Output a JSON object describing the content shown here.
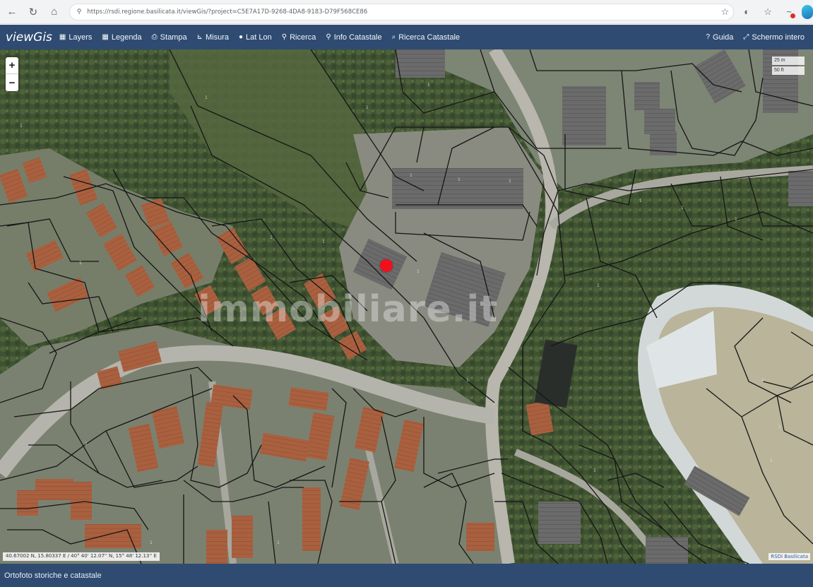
{
  "browser": {
    "url": "https://rsdi.regione.basilicata.it/viewGis/?project=C5E7A17D-9268-4DA8-9183-D79F568CE86",
    "icons": [
      "back-icon",
      "reload-icon",
      "home-icon",
      "lock-icon",
      "star-icon",
      "extension-icon",
      "bookmark-star-icon",
      "alert-extension-icon",
      "profile-icon"
    ]
  },
  "app": {
    "logo": "viewGis",
    "toolbar": {
      "layers": "Layers",
      "legenda": "Legenda",
      "stampa": "Stampa",
      "misura": "Misura",
      "lat_lon": "Lat Lon",
      "ricerca": "Ricerca",
      "info_catastale": "Info Catastale",
      "ricerca_catastale": "Ricerca Catastale",
      "guida": "Guida",
      "schermo_intero": "Schermo intero"
    },
    "toolbar_icons": {
      "layers": "layers-icon",
      "legenda": "legend-icon",
      "stampa": "print-icon",
      "misura": "measure-icon",
      "lat_lon": "globe-icon",
      "ricerca": "pin-icon",
      "info_catastale": "pin-icon",
      "ricerca_catastale": "search-icon",
      "guida": "help-icon",
      "schermo_intero": "fullscreen-icon"
    }
  },
  "map": {
    "zoom_in": "+",
    "zoom_out": "−",
    "coordinates": "40.67002 N, 15.80337 E / 40° 40' 12.07'' N, 15° 48' 12.13'' E",
    "attribution": "RSDI Basilicata",
    "watermark": "immobiliare.it",
    "scale_top": "25 m",
    "scale_bottom": "50 ft",
    "colors": {
      "marker": "#f20f1c",
      "parcel_lines": "#151515",
      "toolbar": "#2f4b72"
    }
  },
  "status": {
    "layer_name": "Ortofoto storiche e catastale"
  }
}
